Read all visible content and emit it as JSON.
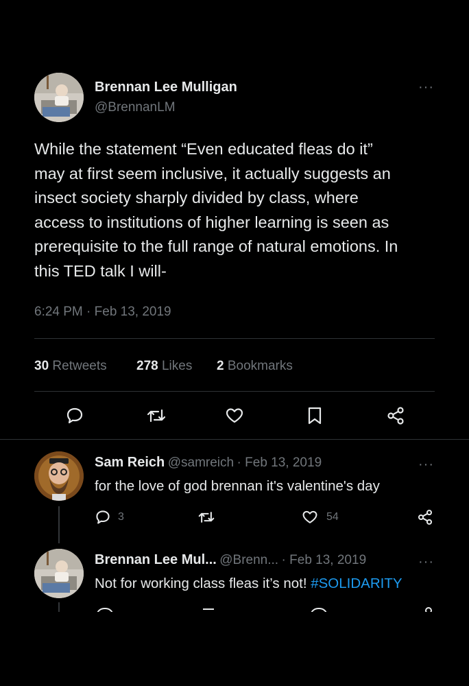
{
  "main_tweet": {
    "author_name": "Brennan Lee Mulligan",
    "author_handle": "@BrennanLM",
    "more": "···",
    "text_lines": [
      "While the statement “Even educated fleas do it”",
      "may at first seem inclusive, it actually suggests an",
      "insect society sharply divided by class, where",
      "access to institutions of higher learning is seen as",
      "prerequisite to the full range of natural emotions. In",
      "this TED talk I will-"
    ],
    "timestamp": "6:24 PM · Feb 13, 2019",
    "stats": {
      "retweets_count": "30",
      "retweets_label": "Retweets",
      "likes_count": "278",
      "likes_label": "Likes",
      "bookmarks_count": "2",
      "bookmarks_label": "Bookmarks"
    },
    "actions": [
      "reply-icon",
      "retweet-icon",
      "like-icon",
      "bookmark-icon",
      "share-icon"
    ]
  },
  "replies": [
    {
      "author_name": "Sam Reich",
      "author_handle": "@samreich",
      "date": "· Feb 13, 2019",
      "more": "···",
      "text": "for the love of god brennan it's valentine's day",
      "reply_count": "3",
      "like_count": "54"
    },
    {
      "author_name": "Brennan Lee Mul...",
      "author_handle": "@Brenn...",
      "date": "· Feb 13, 2019",
      "more": "···",
      "text": "Not for working class fleas it’s not! ",
      "hashtag": "#SOLIDARITY"
    }
  ],
  "colors": {
    "background": "#000000",
    "text": "#e7e9ea",
    "muted": "#71767b",
    "link": "#1d9bf0",
    "divider": "#2f3336"
  }
}
